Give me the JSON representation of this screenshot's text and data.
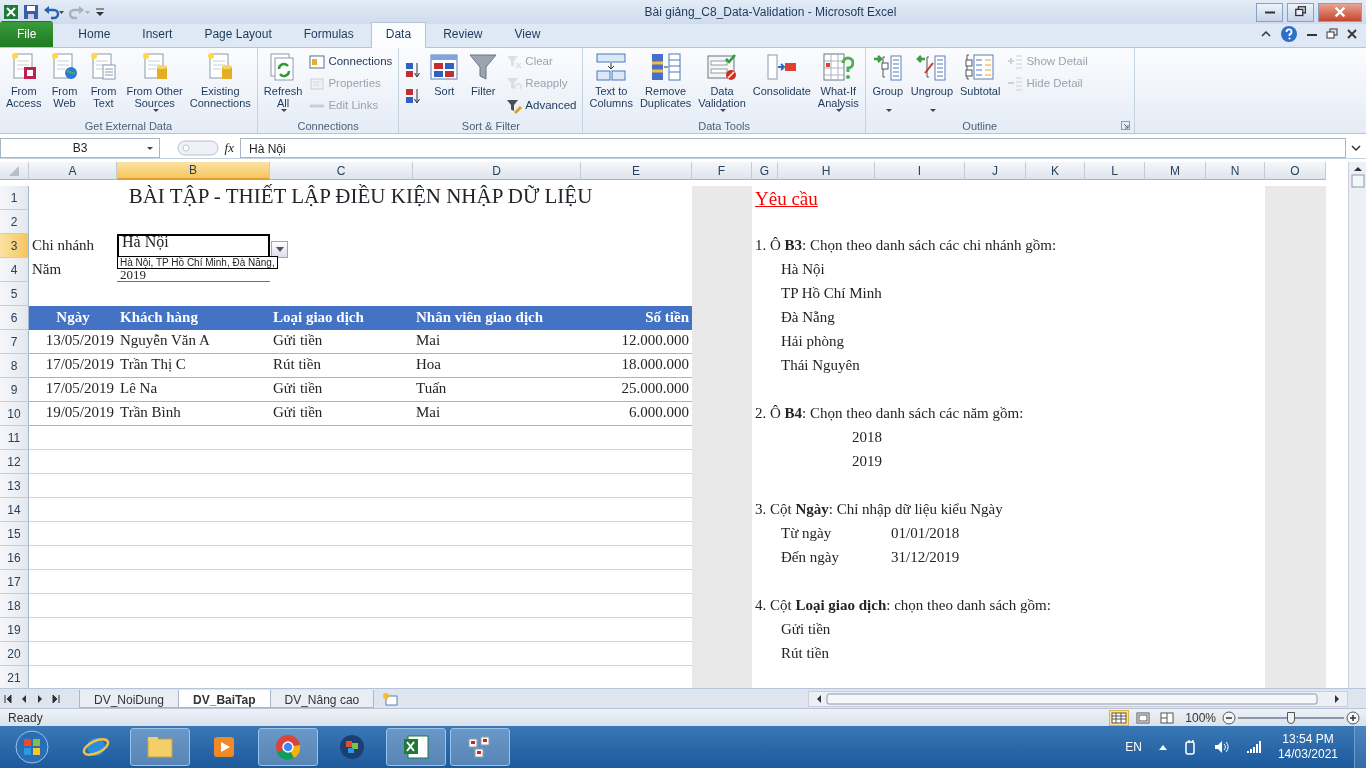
{
  "window": {
    "title": "Bài giảng_C8_Data-Validation  -  Microsoft Excel"
  },
  "ribbon_tabs": [
    {
      "label": "File",
      "kind": "file",
      "selected": false
    },
    {
      "label": "Home",
      "kind": "tab",
      "selected": false
    },
    {
      "label": "Insert",
      "kind": "tab",
      "selected": false
    },
    {
      "label": "Page Layout",
      "kind": "tab",
      "selected": false
    },
    {
      "label": "Formulas",
      "kind": "tab",
      "selected": false
    },
    {
      "label": "Data",
      "kind": "tab",
      "selected": true
    },
    {
      "label": "Review",
      "kind": "tab",
      "selected": false
    },
    {
      "label": "View",
      "kind": "tab",
      "selected": false
    }
  ],
  "ribbon_groups": [
    {
      "label": "Get External Data",
      "items": [
        {
          "kind": "large",
          "label": "From\nAccess",
          "disabled": false,
          "dropdown": false
        },
        {
          "kind": "large",
          "label": "From\nWeb",
          "disabled": false,
          "dropdown": false
        },
        {
          "kind": "large",
          "label": "From\nText",
          "disabled": false,
          "dropdown": false
        },
        {
          "kind": "large",
          "label": "From Other\nSources",
          "disabled": false,
          "dropdown": true
        },
        {
          "kind": "large",
          "label": "Existing\nConnections",
          "disabled": false,
          "dropdown": false
        }
      ]
    },
    {
      "label": "Connections",
      "items": [
        {
          "kind": "large",
          "label": "Refresh\nAll",
          "disabled": false,
          "dropdown": true
        },
        {
          "kind": "small",
          "label": "Connections",
          "disabled": false,
          "dropdown": false
        },
        {
          "kind": "small",
          "label": "Properties",
          "disabled": true,
          "dropdown": false
        },
        {
          "kind": "small",
          "label": "Edit Links",
          "disabled": true,
          "dropdown": false
        }
      ]
    },
    {
      "label": "Sort & Filter",
      "items": [
        {
          "kind": "icon",
          "disabled": false,
          "dropdown": false
        },
        {
          "kind": "icon",
          "disabled": false,
          "dropdown": false
        },
        {
          "kind": "large",
          "label": "Sort",
          "disabled": false,
          "dropdown": false
        },
        {
          "kind": "large",
          "label": "Filter",
          "disabled": false,
          "dropdown": false
        },
        {
          "kind": "small",
          "label": "Clear",
          "disabled": true,
          "dropdown": false
        },
        {
          "kind": "small",
          "label": "Reapply",
          "disabled": true,
          "dropdown": false
        },
        {
          "kind": "small",
          "label": "Advanced",
          "disabled": false,
          "dropdown": false
        }
      ]
    },
    {
      "label": "Data Tools",
      "items": [
        {
          "kind": "large",
          "label": "Text to\nColumns",
          "disabled": false,
          "dropdown": false
        },
        {
          "kind": "large",
          "label": "Remove\nDuplicates",
          "disabled": false,
          "dropdown": false
        },
        {
          "kind": "large",
          "label": "Data\nValidation",
          "disabled": false,
          "dropdown": true
        },
        {
          "kind": "large",
          "label": "Consolidate",
          "disabled": false,
          "dropdown": false
        },
        {
          "kind": "large",
          "label": "What-If\nAnalysis",
          "disabled": false,
          "dropdown": true
        }
      ]
    },
    {
      "label": "Outline",
      "items": [
        {
          "kind": "large",
          "label": "Group",
          "disabled": false,
          "dropdown": true
        },
        {
          "kind": "large",
          "label": "Ungroup",
          "disabled": false,
          "dropdown": true
        },
        {
          "kind": "large",
          "label": "Subtotal",
          "disabled": false,
          "dropdown": false
        },
        {
          "kind": "small",
          "label": "Show Detail",
          "disabled": true,
          "dropdown": false
        },
        {
          "kind": "small",
          "label": "Hide Detail",
          "disabled": true,
          "dropdown": false
        }
      ]
    }
  ],
  "formula_bar": {
    "name_box": "B3",
    "function_button": "fx",
    "formula": "Hà Nội"
  },
  "columns": [
    {
      "label": "A",
      "selected": false
    },
    {
      "label": "B",
      "selected": true
    },
    {
      "label": "C",
      "selected": false
    },
    {
      "label": "D",
      "selected": false
    },
    {
      "label": "E",
      "selected": false
    },
    {
      "label": "F",
      "selected": false
    },
    {
      "label": "G",
      "selected": false
    },
    {
      "label": "H",
      "selected": false
    },
    {
      "label": "I",
      "selected": false
    },
    {
      "label": "J",
      "selected": false
    },
    {
      "label": "K",
      "selected": false
    },
    {
      "label": "L",
      "selected": false
    },
    {
      "label": "M",
      "selected": false
    },
    {
      "label": "N",
      "selected": false
    },
    {
      "label": "O",
      "selected": false
    }
  ],
  "rows": [
    {
      "label": "1",
      "selected": false
    },
    {
      "label": "2",
      "selected": false
    },
    {
      "label": "3",
      "selected": true
    },
    {
      "label": "4",
      "selected": false
    },
    {
      "label": "5",
      "selected": false
    },
    {
      "label": "6",
      "selected": false
    },
    {
      "label": "7",
      "selected": false
    },
    {
      "label": "8",
      "selected": false
    },
    {
      "label": "9",
      "selected": false
    },
    {
      "label": "10",
      "selected": false
    },
    {
      "label": "11",
      "selected": false
    },
    {
      "label": "12",
      "selected": false
    },
    {
      "label": "13",
      "selected": false
    },
    {
      "label": "14",
      "selected": false
    },
    {
      "label": "15",
      "selected": false
    },
    {
      "label": "16",
      "selected": false
    },
    {
      "label": "17",
      "selected": false
    },
    {
      "label": "18",
      "selected": false
    },
    {
      "label": "19",
      "selected": false
    },
    {
      "label": "20",
      "selected": false
    },
    {
      "label": "21",
      "selected": false
    }
  ],
  "sheet": {
    "title": "BÀI TẬP - THIẾT LẬP ĐIỀU KIỆN NHẬP DỮ LIỆU",
    "branch_label": "Chi nhánh",
    "branch_value": "Hà Nội",
    "validation_tip": "Hà Nội, TP Hồ Chí Minh, Đà Nẵng,",
    "year_label": "Năm",
    "year_value": "2019"
  },
  "table": {
    "columns": [
      "Ngày",
      "Khách hàng",
      "Loại giao dịch",
      "Nhân viên giao dịch",
      "Số tiền"
    ],
    "rows": [
      [
        "13/05/2019",
        "Nguyễn Văn A",
        "Gửi tiền",
        "Mai",
        "12.000.000"
      ],
      [
        "17/05/2019",
        "Trần Thị C",
        "Rút tiền",
        "Hoa",
        "18.000.000"
      ],
      [
        "17/05/2019",
        "Lê Na",
        "Gửi tiền",
        "Tuấn",
        "25.000.000"
      ],
      [
        "19/05/2019",
        "Trần Bình",
        "Gửi tiền",
        "Mai",
        "6.000.000"
      ]
    ]
  },
  "requirements": {
    "title": "Yêu cầu",
    "blocks": [
      {
        "kind": "list",
        "heading": "1. Ô **B3**: Chọn theo danh sách các chi nhánh gồm:",
        "items": [
          [
            "Hà Nội"
          ],
          [
            "TP Hồ Chí Minh"
          ],
          [
            "Đà Nẵng"
          ],
          [
            "Hải phòng"
          ],
          [
            "Thái Nguyên"
          ]
        ]
      },
      {
        "kind": "years",
        "heading": "2. Ô **B4**: Chọn theo danh sách các năm gồm:",
        "items": [
          [
            "2018"
          ],
          [
            "2019"
          ]
        ]
      },
      {
        "kind": "range",
        "heading": "3. Cột **Ngày**: Chỉ nhập dữ liệu kiểu Ngày",
        "items": [
          [
            "Từ ngày",
            "01/01/2018"
          ],
          [
            "Đến ngày",
            "31/12/2019"
          ]
        ]
      },
      {
        "kind": "list",
        "heading": "4. Cột **Loại giao dịch**: chọn theo danh sách gồm:",
        "items": [
          [
            "Gửi tiền"
          ],
          [
            "Rút tiền"
          ]
        ]
      }
    ]
  },
  "sheet_tabs": [
    {
      "label": "DV_NoiDung",
      "selected": false
    },
    {
      "label": "DV_BaiTap",
      "selected": true
    },
    {
      "label": "DV_Nâng cao",
      "selected": false
    }
  ],
  "status_bar": {
    "text": "Ready",
    "view_modes": [
      {
        "selected": true
      },
      {
        "selected": false
      },
      {
        "selected": false
      }
    ],
    "zoom": "100%",
    "zoom_slider": {
      "level": 0.5
    }
  },
  "taskbar": {
    "apps": [
      {
        "running": false
      },
      {
        "running": true
      },
      {
        "running": false
      },
      {
        "running": true
      },
      {
        "running": false
      },
      {
        "running": true
      },
      {
        "running": true
      }
    ],
    "language": "EN",
    "time": "13:54 PM",
    "date": "14/03/2021"
  }
}
